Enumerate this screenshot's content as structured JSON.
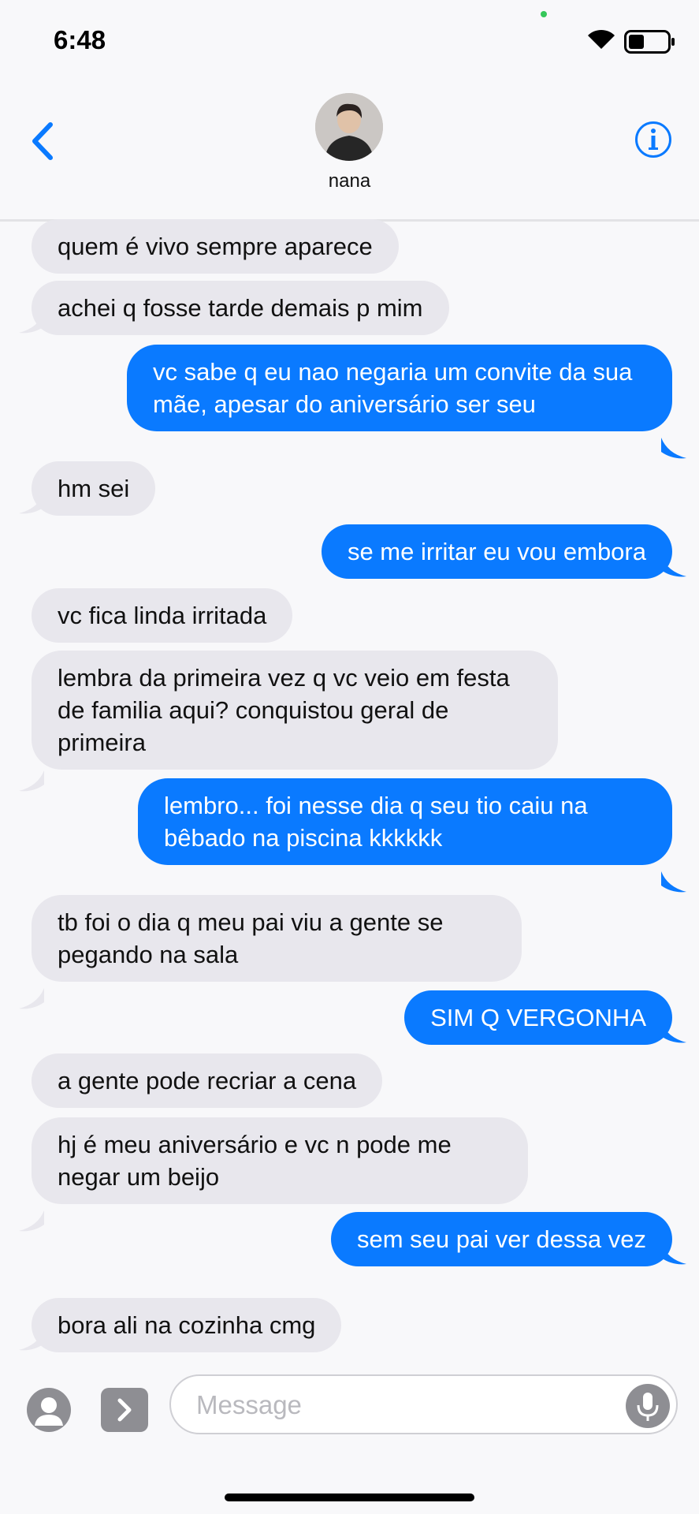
{
  "status": {
    "time": "6:48",
    "battery_level": 0.4
  },
  "contact": {
    "name": "nana"
  },
  "colors": {
    "accent": "#0a7aff",
    "incoming_bubble": "#e8e7ed"
  },
  "icons": [
    "chevron-left-icon",
    "info-icon",
    "wifi-icon",
    "battery-icon",
    "person-icon",
    "app-store-icon",
    "microphone-icon"
  ],
  "messages": [
    {
      "direction": "in",
      "text": "quem é vivo sempre aparece"
    },
    {
      "direction": "in",
      "text": "achei q fosse tarde demais p mim"
    },
    {
      "direction": "out",
      "text": "vc sabe q eu nao negaria um convite da sua mãe, apesar do aniversário ser seu"
    },
    {
      "direction": "in",
      "text": "hm sei"
    },
    {
      "direction": "out",
      "text": "se me irritar eu vou embora"
    },
    {
      "direction": "in",
      "text": "vc fica linda irritada"
    },
    {
      "direction": "in",
      "text": "lembra da primeira vez q vc veio em festa de familia aqui? conquistou geral de primeira"
    },
    {
      "direction": "out",
      "text": "lembro... foi nesse dia q seu tio caiu na bêbado na piscina kkkkkk"
    },
    {
      "direction": "in",
      "text": "tb foi o dia q meu pai viu a gente se pegando na sala"
    },
    {
      "direction": "out",
      "text": "SIM Q VERGONHA"
    },
    {
      "direction": "in",
      "text": "a gente pode recriar a cena"
    },
    {
      "direction": "in",
      "text": "hj é meu aniversário e vc n pode me negar um beijo"
    },
    {
      "direction": "out",
      "text": "sem seu pai ver dessa vez"
    },
    {
      "direction": "in",
      "text": "bora ali na cozinha cmg"
    }
  ],
  "composer": {
    "placeholder": "Message",
    "value": ""
  }
}
